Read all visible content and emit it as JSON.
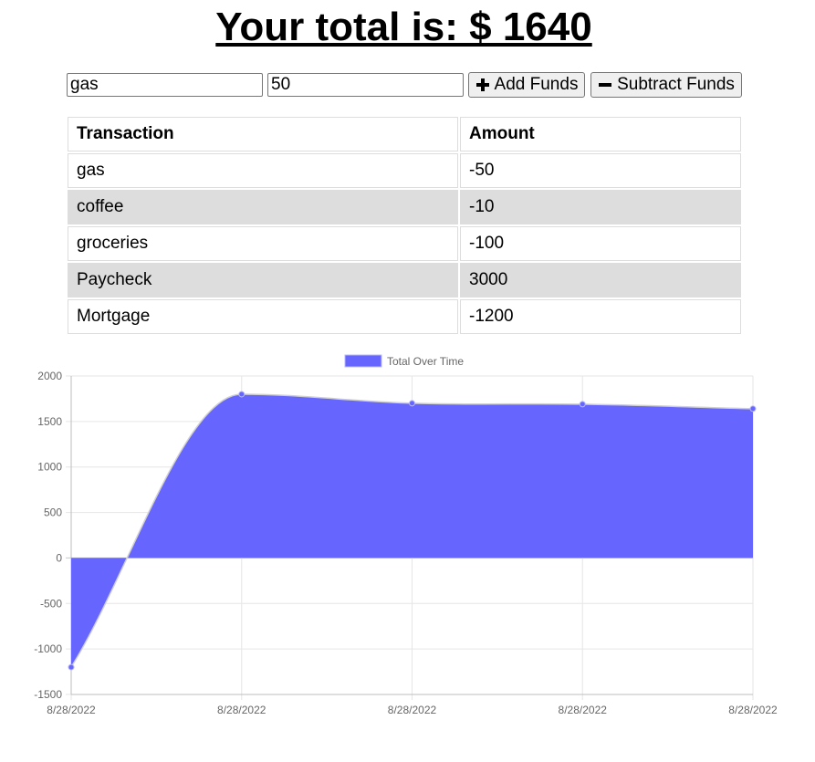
{
  "header": {
    "title": "Your total is: $ 1640"
  },
  "form": {
    "name_value": "gas",
    "amount_value": "50",
    "add_label": "Add Funds",
    "subtract_label": "Subtract Funds"
  },
  "table": {
    "headers": [
      "Transaction",
      "Amount"
    ],
    "rows": [
      {
        "name": "gas",
        "amount": "-50"
      },
      {
        "name": "coffee",
        "amount": "-10"
      },
      {
        "name": "groceries",
        "amount": "-100"
      },
      {
        "name": "Paycheck",
        "amount": "3000"
      },
      {
        "name": "Mortgage",
        "amount": "-1200"
      }
    ]
  },
  "colors": {
    "series_fill": "#6666ff",
    "row_alt": "#dddddd"
  },
  "chart_data": {
    "type": "area",
    "x": [
      "8/28/2022",
      "8/28/2022",
      "8/28/2022",
      "8/28/2022",
      "8/28/2022"
    ],
    "series": [
      {
        "name": "Total Over Time",
        "values": [
          -1200,
          1800,
          1700,
          1690,
          1640
        ]
      }
    ],
    "ylim": [
      -1500,
      2000
    ],
    "yticks": [
      -1500,
      -1000,
      -500,
      0,
      500,
      1000,
      1500,
      2000
    ],
    "grid": true,
    "legend": "top-center"
  }
}
